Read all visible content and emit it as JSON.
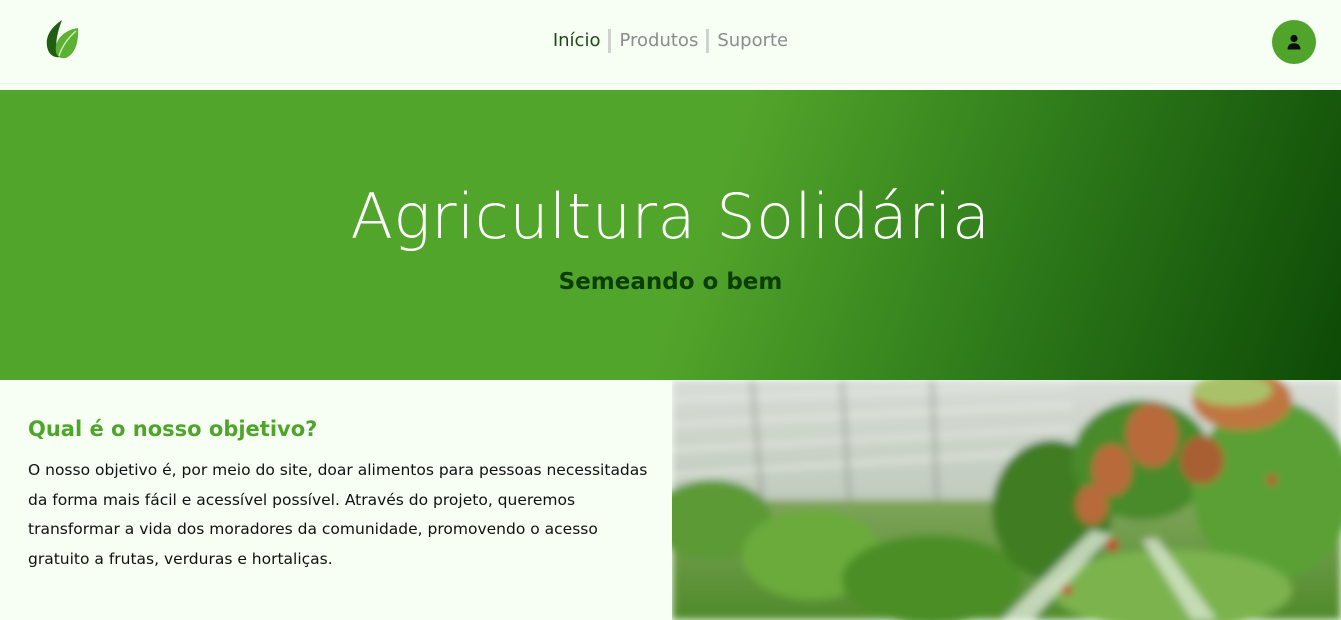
{
  "header": {
    "logo_icon": "leaf-icon",
    "nav": [
      {
        "label": "Início",
        "active": true
      },
      {
        "label": "Produtos",
        "active": false
      },
      {
        "label": "Suporte",
        "active": false
      }
    ],
    "user_icon": "user-icon"
  },
  "hero": {
    "title": "Agricultura Solidária",
    "subtitle": "Semeando o bem"
  },
  "about": {
    "title": "Qual é o nosso objetivo?",
    "text": "O nosso objetivo é, por meio do site, doar alimentos para pessoas necessitadas da forma mais fácil e acessível possível. Através do projeto, queremos transformar a vida dos moradores da comunidade, promovendo o acesso gratuito a frutas, verduras e hortaliças."
  },
  "colors": {
    "brand_green": "#51a42b",
    "dark_green": "#0b3d05",
    "background": "#f7fff5"
  }
}
